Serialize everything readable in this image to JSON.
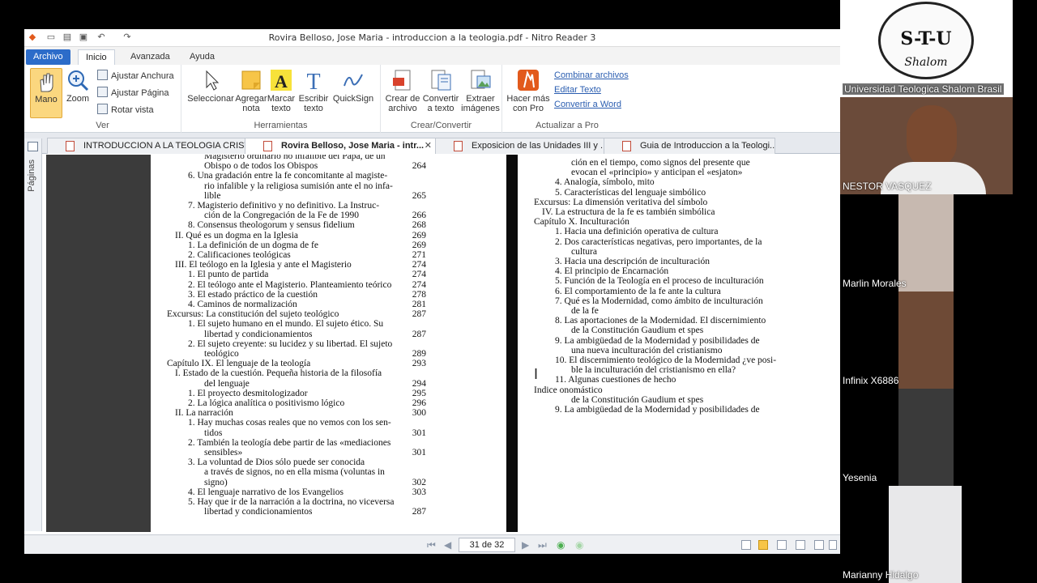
{
  "window": {
    "title": "Rovira Belloso, Jose Maria - introduccion a la teologia.pdf - Nitro Reader 3"
  },
  "ribbon_tabs": [
    "Archivo",
    "Inicio",
    "Avanzada",
    "Ayuda"
  ],
  "ribbon": {
    "ver": {
      "label": "Ver",
      "mano": "Mano",
      "zoom": "Zoom",
      "ajustar_anchura": "Ajustar Anchura",
      "ajustar_pagina": "Ajustar Página",
      "rotar_vista": "Rotar vista"
    },
    "herramientas": {
      "label": "Herramientas",
      "seleccionar": "Seleccionar",
      "agregar_nota": "Agregar nota",
      "marcar_texto": "Marcar texto",
      "escribir_texto": "Escribir texto",
      "quicksign": "QuickSign"
    },
    "crear": {
      "label": "Crear/Convertir",
      "crear_archivo": "Crear de archivo",
      "convertir_texto": "Convertir a texto",
      "extraer_imagenes": "Extraer imágenes"
    },
    "actualizar": {
      "label": "Actualizar a Pro",
      "hacer_mas": "Hacer más con Pro",
      "combinar": "Combinar archivos",
      "editar_texto": "Editar Texto",
      "convertir_word": "Convertir a Word"
    }
  },
  "doc_tabs": [
    {
      "label": "INTRODUCCION A LA TEOLOGIA CRISTI...",
      "active": false
    },
    {
      "label": "Rovira Belloso, Jose Maria - intr...",
      "active": true
    },
    {
      "label": "Exposicion de las Unidades III y ...",
      "active": false
    },
    {
      "label": "Guia de Introduccion a la Teologi...",
      "active": false
    }
  ],
  "side_panel": {
    "label": "Páginas"
  },
  "left_page": [
    {
      "t": "Magisterio ordinario no infalible del Papa, de un",
      "n": ""
    },
    {
      "t": "Obispo o de todos los Obispos",
      "n": "264"
    },
    {
      "t": "6.  Una gradación entre la fe concomitante al magiste-",
      "n": ""
    },
    {
      "t": "rio infalible y la religiosa sumisión ante el no infa-",
      "n": ""
    },
    {
      "t": "lible",
      "n": "265"
    },
    {
      "t": "7.  Magisterio definitivo y no definitivo. La Instruc-",
      "n": ""
    },
    {
      "t": "ción de la Congregación de la Fe de 1990",
      "n": "266"
    },
    {
      "t": "8.  Consensus theologorum y sensus fidelium",
      "n": "268"
    },
    {
      "t": "II.  Qué es un dogma en la Iglesia",
      "n": "269"
    },
    {
      "t": "1.  La definición de un dogma de fe",
      "n": "269"
    },
    {
      "t": "2.  Calificaciones teológicas",
      "n": "271"
    },
    {
      "t": "III.  El teólogo en la Iglesia y ante el Magisterio",
      "n": "274"
    },
    {
      "t": "1.  El punto de partida",
      "n": "274"
    },
    {
      "t": "2.  El teólogo ante el Magisterio. Planteamiento teórico",
      "n": "274"
    },
    {
      "t": "3.  El estado práctico de la cuestión",
      "n": "278"
    },
    {
      "t": "4.  Caminos de normalización",
      "n": "281"
    },
    {
      "t": "Excursus: La constitución del sujeto teológico",
      "n": "287"
    },
    {
      "t": "1.  El sujeto humano en el mundo. El sujeto ético. Su",
      "n": ""
    },
    {
      "t": "libertad y condicionamientos",
      "n": "287"
    },
    {
      "t": "2.  El sujeto creyente: su lucidez y su libertad. El sujeto",
      "n": ""
    },
    {
      "t": "teológico",
      "n": "289"
    },
    {
      "t": "Capítulo IX.  El lenguaje de la teología",
      "n": "293"
    },
    {
      "t": "I.  Estado de la cuestión. Pequeña historia de la filosofía",
      "n": ""
    },
    {
      "t": "del lenguaje",
      "n": "294"
    },
    {
      "t": "1.  El proyecto desmitologizador",
      "n": "295"
    },
    {
      "t": "2.  La lógica analítica o positivismo lógico",
      "n": "296"
    },
    {
      "t": "II.  La narración",
      "n": "300"
    },
    {
      "t": "1.  Hay muchas cosas reales que no vemos con los sen-",
      "n": ""
    },
    {
      "t": "tidos",
      "n": "301"
    },
    {
      "t": "2.  También la teología debe partir de las «mediaciones",
      "n": ""
    },
    {
      "t": "sensibles»",
      "n": "301"
    },
    {
      "t": "3.  La voluntad de Dios sólo puede ser conocida",
      "n": ""
    },
    {
      "t": "a través de signos, no en ella misma (voluntas in",
      "n": ""
    },
    {
      "t": "signo)",
      "n": "302"
    },
    {
      "t": "4.  El lenguaje narrativo de los Evangelios",
      "n": "303"
    },
    {
      "t": "5.  Hay que ir de la narración a la doctrina, no viceversa",
      "n": ""
    },
    {
      "t": "libertad y condicionamientos",
      "n": "287"
    }
  ],
  "right_page": [
    {
      "t": "ción en el tiempo, como signos del presente que",
      "n": ""
    },
    {
      "t": "evocan el «principio» y anticipan el «esjaton»",
      "n": ""
    },
    {
      "t": "4.  Analogía, símbolo, mito",
      "n": ""
    },
    {
      "t": "5.  Características del lenguaje simbólico",
      "n": ""
    },
    {
      "t": "Excursus: La dimensión veritativa del símbolo",
      "n": ""
    },
    {
      "t": "IV.  La estructura de la fe es también simbólica",
      "n": ""
    },
    {
      "t": "Capítulo X.  Inculturación",
      "n": ""
    },
    {
      "t": "1.  Hacia una definición operativa de cultura",
      "n": ""
    },
    {
      "t": "2.  Dos características negativas, pero importantes, de la",
      "n": ""
    },
    {
      "t": "cultura",
      "n": ""
    },
    {
      "t": "3.  Hacia una descripción de inculturación",
      "n": ""
    },
    {
      "t": "4.  El principio de Encarnación",
      "n": ""
    },
    {
      "t": "5.  Función de la Teología en el proceso de inculturación",
      "n": ""
    },
    {
      "t": "6.  El comportamiento de la fe ante la cultura",
      "n": ""
    },
    {
      "t": "7.  Qué es la Modernidad, como ámbito de inculturación",
      "n": ""
    },
    {
      "t": "de la fe",
      "n": ""
    },
    {
      "t": "8.  Las aportaciones de la Modernidad. El discernimiento",
      "n": ""
    },
    {
      "t": "de la Constitución Gaudium et spes",
      "n": ""
    },
    {
      "t": "9.  La ambigüedad de la Modernidad y posibilidades de",
      "n": ""
    },
    {
      "t": "una nueva inculturación del cristianismo",
      "n": ""
    },
    {
      "t": "10.  El discernimiento teológico de la Modernidad ¿ve posi-",
      "n": ""
    },
    {
      "t": "ble la inculturación del cristianismo en ella?",
      "n": ""
    },
    {
      "t": "11.  Algunas cuestiones de hecho",
      "n": ""
    },
    {
      "t": "Indice onomástico",
      "n": ""
    },
    {
      "t": "de la Constitución Gaudium et spes",
      "n": ""
    },
    {
      "t": "9.  La ambigüedad de la Modernidad y posibilidades de",
      "n": ""
    }
  ],
  "status": {
    "page": "31 de 32"
  },
  "participants": [
    {
      "name": "Universidad Teologica Shalom Brasil",
      "logo": "S-T-U",
      "logo_sub": "Shalom"
    },
    {
      "name": "NESTOR VASQUEZ"
    },
    {
      "name": "Marlin Morales"
    },
    {
      "name": "Infinix X6886"
    },
    {
      "name": "Yesenia"
    },
    {
      "name": "Marianny Hidalgo"
    }
  ],
  "colors": {
    "accent": "#2c6cc9",
    "link": "#2a5db0",
    "highlight": "#f7c548"
  }
}
